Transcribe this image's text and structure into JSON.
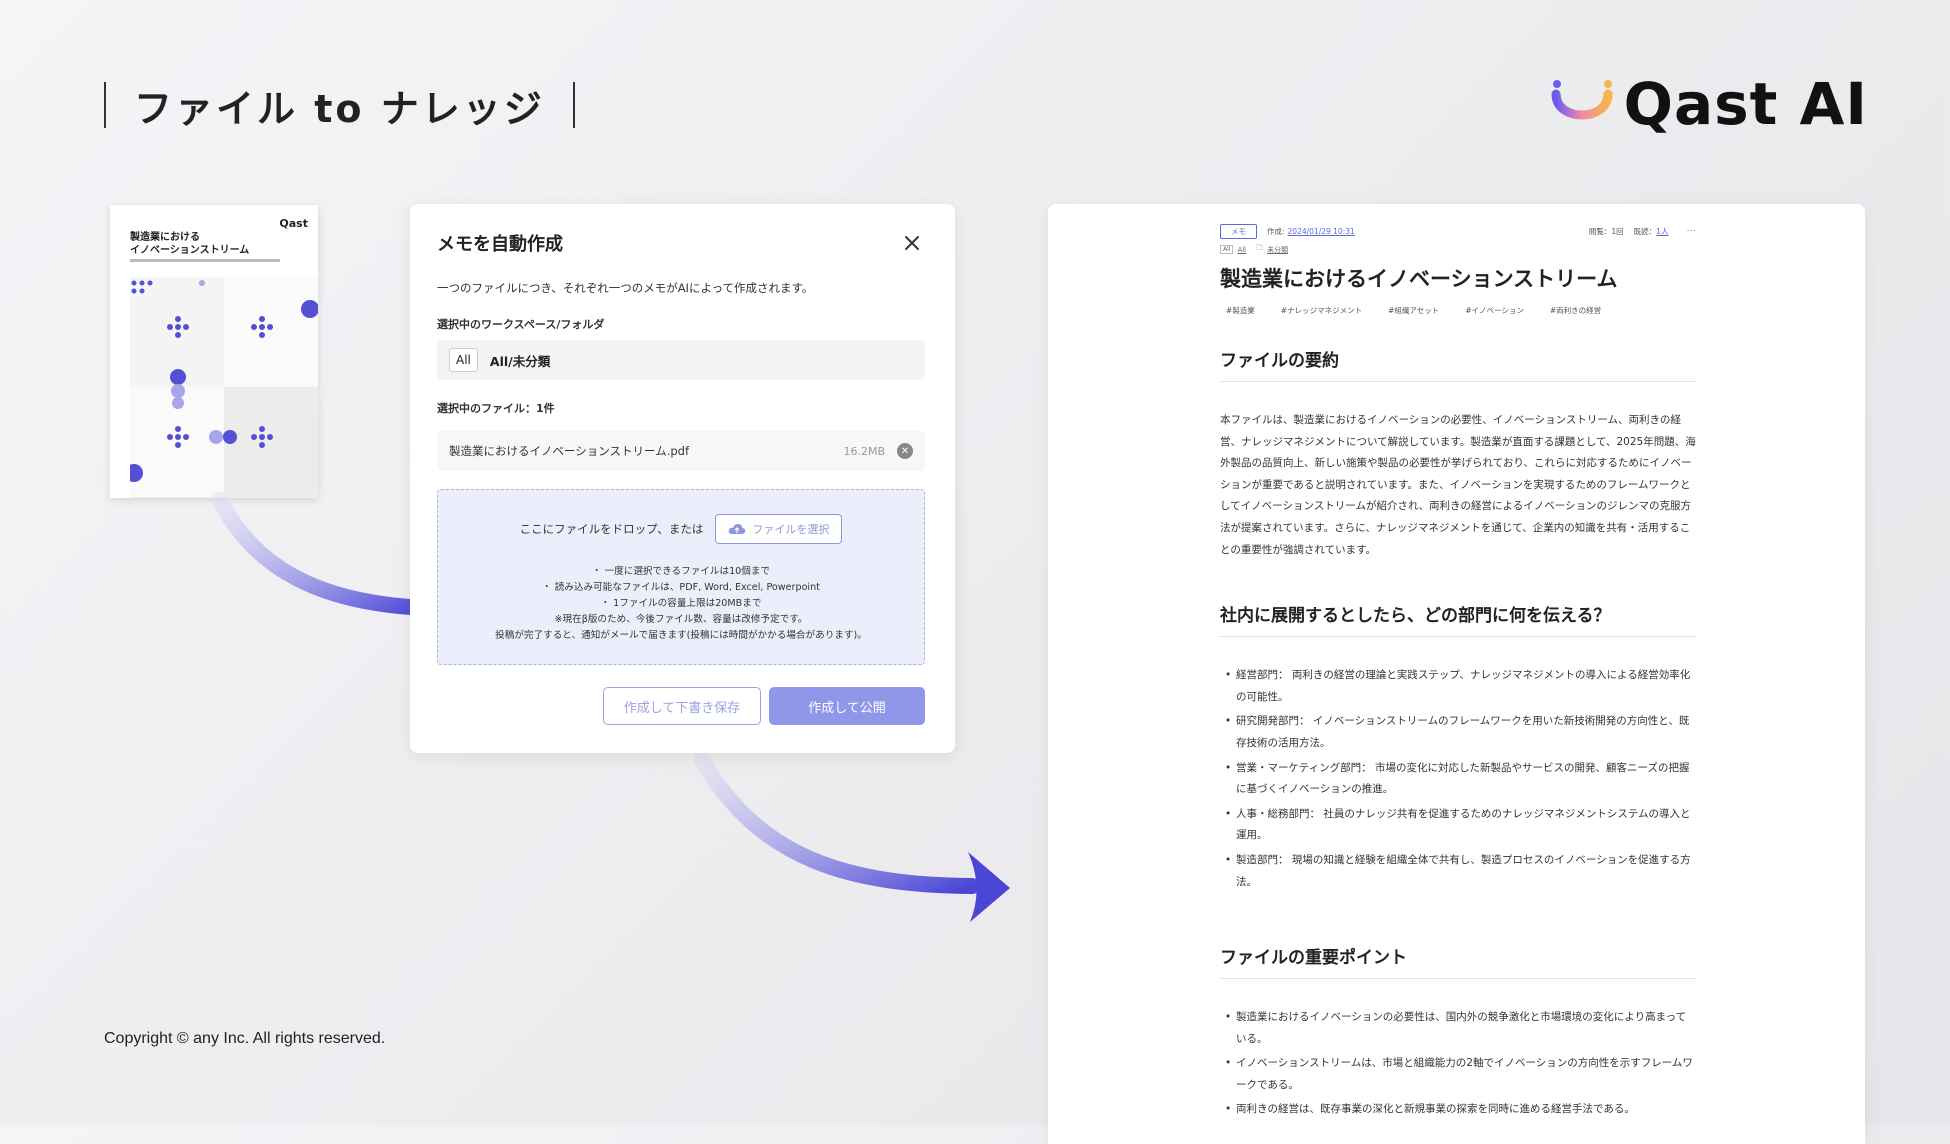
{
  "header": {
    "title": "ファイル to ナレッジ",
    "brand": "Qast AI"
  },
  "footer": {
    "copyright": "Copyright © any Inc. All rights reserved."
  },
  "thumbnail": {
    "logo": "Qast",
    "title": "製造業における\nイノベーションストリーム"
  },
  "dialog": {
    "title": "メモを自動作成",
    "description": "一つのファイルにつき、それぞれ一つのメモがAIによって作成されます。",
    "workspace_label": "選択中のワークスペース/フォルダ",
    "workspace_badge": "All",
    "workspace_name": "All/未分類",
    "file_label": "選択中のファイル：1件",
    "file_name": "製造業におけるイノベーションストリーム.pdf",
    "file_size": "16.2MB",
    "drop_text": "ここにファイルをドロップ、または",
    "pick_button": "ファイルを選択",
    "notes": [
      "・ 一度に選択できるファイルは10個まで",
      "・ 読み込み可能なファイルは、PDF, Word, Excel, Powerpoint",
      "・ 1ファイルの容量上限は20MBまで",
      "※現在β版のため、今後ファイル数、容量は改修予定です。",
      "投稿が完了すると、通知がメールで届きます(投稿には時間がかかる場合があります)。"
    ],
    "draft_button": "作成して下書き保存",
    "publish_button": "作成して公開"
  },
  "memo": {
    "badge": "メモ",
    "created_label": "作成:",
    "created_date": "2024/01/29 10:31",
    "views": "閲覧：1回",
    "viewers_label": "既読：",
    "viewers_link": "1人",
    "crumb_ws": "All",
    "crumb_folder": "未分類",
    "title": "製造業におけるイノベーションストリーム",
    "tags": [
      "#製造業",
      "#ナレッジマネジメント",
      "#組織アセット",
      "#イノベーション",
      "#両利きの経営"
    ],
    "summary_heading": "ファイルの要約",
    "summary": "本ファイルは、製造業におけるイノベーションの必要性、イノベーションストリーム、両利きの経営、ナレッジマネジメントについて解説しています。製造業が直面する課題として、2025年問題、海外製品の品質向上、新しい施策や製品の必要性が挙げられており、これらに対応するためにイノベーションが重要であると説明されています。また、イノベーションを実現するためのフレームワークとしてイノベーションストリームが紹介され、両利きの経営によるイノベーションのジレンマの克服方法が提案されています。さらに、ナレッジマネジメントを通じて、企業内の知識を共有・活用することの重要性が強調されています。",
    "dept_heading": "社内に展開するとしたら、どの部門に何を伝える？",
    "dept_items": [
      "経営部門： 両利きの経営の理論と実践ステップ、ナレッジマネジメントの導入による経営効率化の可能性。",
      "研究開発部門： イノベーションストリームのフレームワークを用いた新技術開発の方向性と、既存技術の活用方法。",
      "営業・マーケティング部門： 市場の変化に対応した新製品やサービスの開発、顧客ニーズの把握に基づくイノベーションの推進。",
      "人事・総務部門： 社員のナレッジ共有を促進するためのナレッジマネジメントシステムの導入と運用。",
      "製造部門： 現場の知識と経験を組織全体で共有し、製造プロセスのイノベーションを促進する方法。"
    ],
    "points_heading": "ファイルの重要ポイント",
    "points": [
      "製造業におけるイノベーションの必要性は、国内外の競争激化と市場環境の変化により高まっている。",
      "イノベーションストリームは、市場と組織能力の2軸でイノベーションの方向性を示すフレームワークである。",
      "両利きの経営は、既存事業の深化と新規事業の探索を同時に進める経営手法である。"
    ]
  },
  "colors": {
    "accent": "#5f68d8",
    "button_primary": "#8f98e8",
    "dropzone_bg": "#eceefb"
  }
}
